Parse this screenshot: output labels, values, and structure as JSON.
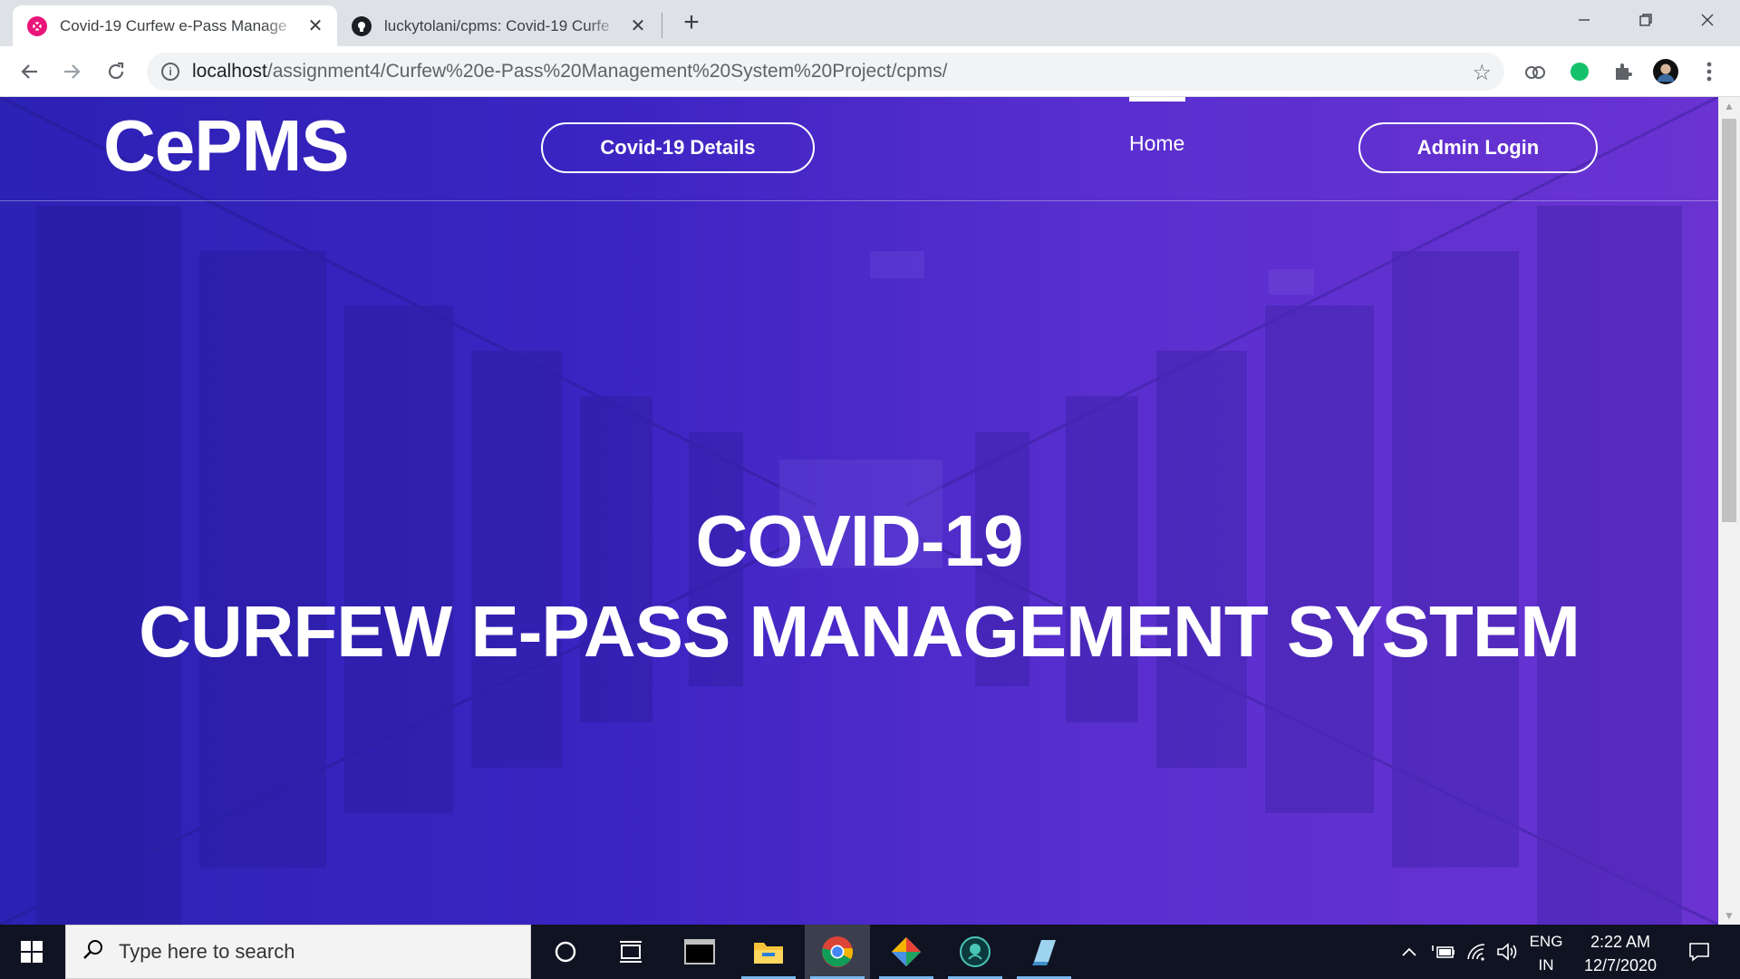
{
  "browser": {
    "tabs": [
      {
        "title": "Covid-19 Curfew e-Pass Manage",
        "favicon": "xampp-icon",
        "active": true
      },
      {
        "title": "luckytolani/cpms: Covid-19 Curfe",
        "favicon": "github-icon",
        "active": false
      }
    ],
    "url_host": "localhost",
    "url_path": "/assignment4/Curfew%20e-Pass%20Management%20System%20Project/cpms/"
  },
  "page": {
    "brand": "CePMS",
    "nav": {
      "covid_details": "Covid-19 Details",
      "home": "Home",
      "admin_login": "Admin Login"
    },
    "hero_line1": "COVID-19",
    "hero_line2": "CURFEW E-PASS MANAGEMENT SYSTEM",
    "colors": {
      "gradient_start": "#2c22b4",
      "gradient_end": "#6a33d2",
      "text": "#ffffff"
    }
  },
  "taskbar": {
    "search_placeholder": "Type here to search",
    "lang_line1": "ENG",
    "lang_line2": "IN",
    "time": "2:22 AM",
    "date": "12/7/2020"
  }
}
